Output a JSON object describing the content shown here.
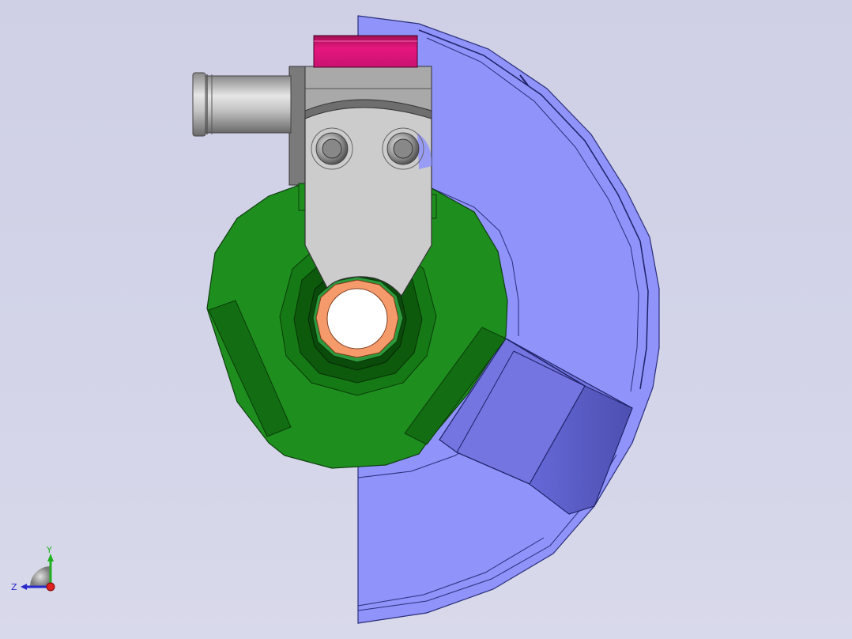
{
  "viewport": {
    "background_color": "#d2d3e7"
  },
  "model": {
    "parts": [
      {
        "name": "transparent-housing",
        "color": "#8f93fa"
      },
      {
        "name": "green-rotor",
        "color": "#1e8f1e"
      },
      {
        "name": "gray-bracket",
        "color": "#c9c9c9"
      },
      {
        "name": "pink-block",
        "color": "#e0167a"
      },
      {
        "name": "orange-bushing",
        "color": "#f59a6a"
      },
      {
        "name": "cylinder-shaft",
        "color": "#b8b8b8"
      }
    ]
  },
  "triad": {
    "axes": [
      {
        "label": "Y",
        "color": "#22b022"
      },
      {
        "label": "Z",
        "color": "#2a2acc"
      },
      {
        "label": "X",
        "color": "#e02020"
      }
    ]
  }
}
